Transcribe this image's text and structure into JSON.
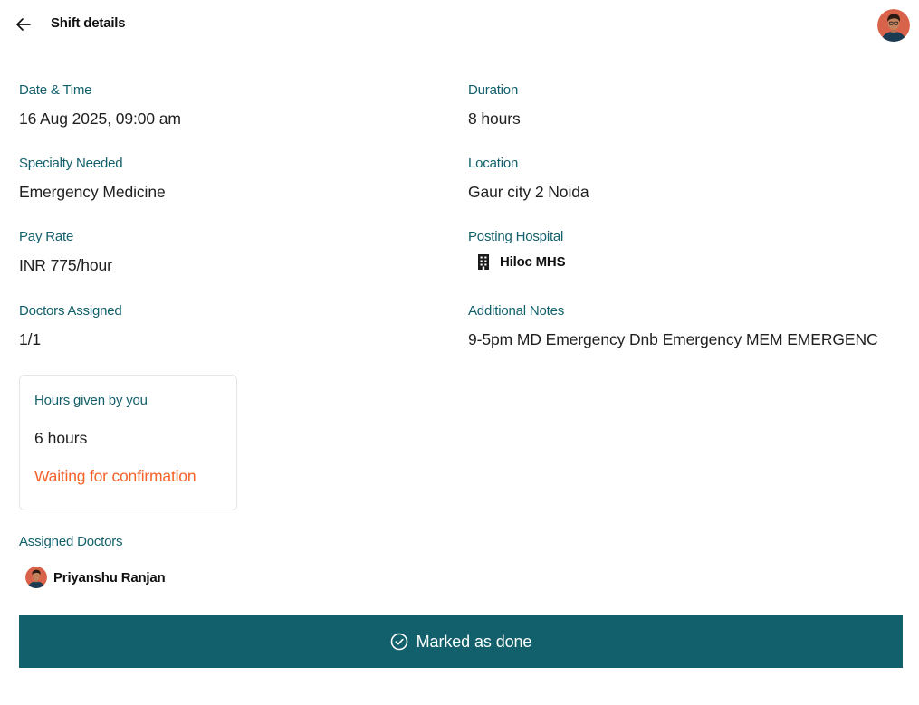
{
  "header": {
    "title": "Shift details",
    "back_icon": "arrow-left-icon",
    "avatar_icon": "user-avatar"
  },
  "details": {
    "date_time": {
      "label": "Date & Time",
      "value": "16 Aug 2025, 09:00 am"
    },
    "duration": {
      "label": "Duration",
      "value": "8 hours"
    },
    "specialty": {
      "label": "Specialty Needed",
      "value": "Emergency Medicine"
    },
    "location": {
      "label": "Location",
      "value": "Gaur city 2 Noida"
    },
    "pay_rate": {
      "label": "Pay Rate",
      "value": "INR 775/hour"
    },
    "posting_hospital": {
      "label": "Posting Hospital",
      "value": "Hiloc MHS",
      "icon": "building-icon"
    },
    "doctors_assigned": {
      "label": "Doctors Assigned",
      "value": "1/1"
    },
    "notes": {
      "label": "Additional Notes",
      "value": "9-5pm MD Emergency Dnb Emergency MEM EMERGENC"
    }
  },
  "hours_card": {
    "label": "Hours given by you",
    "value": "6 hours",
    "status": "Waiting for confirmation"
  },
  "assigned_doctors": {
    "title": "Assigned Doctors",
    "doctors": [
      {
        "name": "Priyanshu Ranjan"
      }
    ]
  },
  "action": {
    "label": "Marked as done",
    "icon": "check-circle-icon"
  },
  "colors": {
    "primary": "#12606b",
    "label": "#12606b",
    "status_warning": "#f4632a",
    "card_border": "#e3e6e8"
  }
}
